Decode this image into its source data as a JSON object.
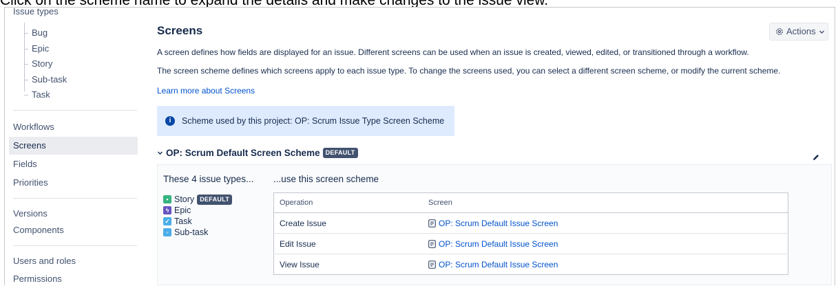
{
  "caption": "Click on the scheme name to expand the details and make changes to the issue view.",
  "sidebar": {
    "heading": "Issue types",
    "issue_types": [
      "Bug",
      "Epic",
      "Story",
      "Sub-task",
      "Task"
    ],
    "items": [
      {
        "label": "Workflows"
      },
      {
        "label": "Screens",
        "active": true
      },
      {
        "label": "Fields"
      },
      {
        "label": "Priorities"
      },
      {
        "label": "Versions"
      },
      {
        "label": "Components"
      },
      {
        "label": "Users and roles"
      },
      {
        "label": "Permissions"
      }
    ]
  },
  "main": {
    "title": "Screens",
    "actions_label": "Actions",
    "description_1": "A screen defines how fields are displayed for an issue. Different screens can be used when an issue is created, viewed, edited, or transitioned through a workflow.",
    "description_2": "The screen scheme defines which screens apply to each issue type. To change the screens used, you can select a different screen scheme, or modify the current scheme.",
    "learn_more": "Learn more about Screens",
    "info_text": "Scheme used by this project: OP: Scrum Issue Type Screen Scheme",
    "scheme_name": "OP: Scrum Default Screen Scheme",
    "scheme_badge": "DEFAULT",
    "issue_types_heading": "These 4 issue types...",
    "use_scheme_heading": "...use this screen scheme",
    "issue_types": [
      {
        "name": "Story",
        "badge": "DEFAULT",
        "icon": "story-icon",
        "color": "#36b37e"
      },
      {
        "name": "Epic",
        "icon": "epic-icon",
        "color": "#6554c0"
      },
      {
        "name": "Task",
        "icon": "task-icon",
        "color": "#4bade8"
      },
      {
        "name": "Sub-task",
        "icon": "subtask-icon",
        "color": "#4bade8"
      }
    ],
    "table": {
      "columns": [
        "Operation",
        "Screen"
      ],
      "rows": [
        {
          "operation": "Create Issue",
          "screen": "OP: Scrum Default Issue Screen"
        },
        {
          "operation": "Edit Issue",
          "screen": "OP: Scrum Default Issue Screen"
        },
        {
          "operation": "View Issue",
          "screen": "OP: Scrum Default Issue Screen"
        }
      ]
    }
  },
  "colors": {
    "link": "#0052cc",
    "info_bg": "#deebff",
    "active_bg": "#ebecf0"
  }
}
